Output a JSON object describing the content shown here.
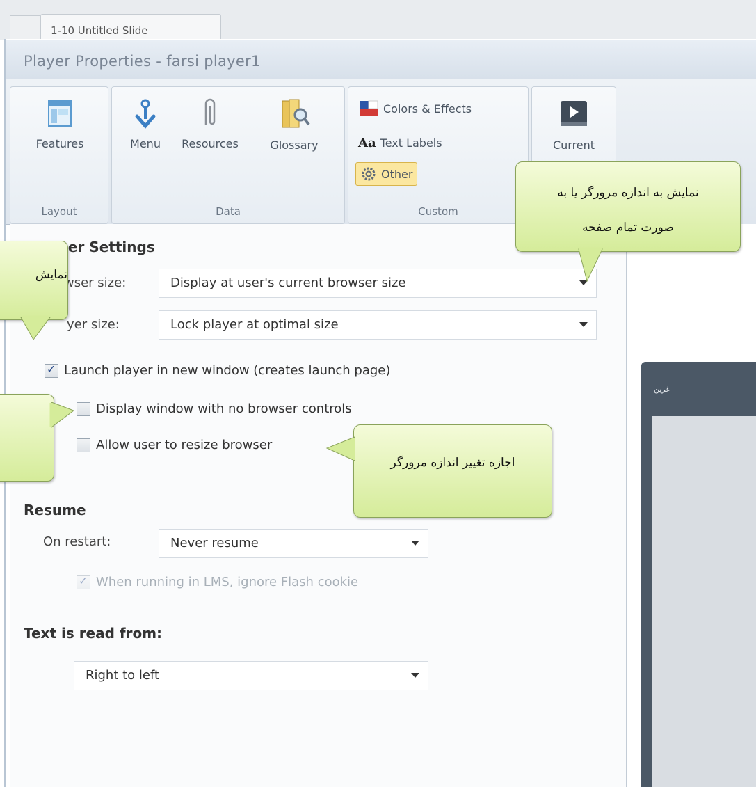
{
  "tab": {
    "label": "1-10 Untitled Slide"
  },
  "window": {
    "title": "Player Properties - farsi player1"
  },
  "ribbon": {
    "groups": [
      {
        "label": "Layout",
        "buttons": [
          {
            "label": "Features",
            "icon": "features-icon"
          }
        ]
      },
      {
        "label": "Data",
        "buttons": [
          {
            "label": "Menu",
            "icon": "menu-icon"
          },
          {
            "label": "Resources",
            "icon": "paperclip-icon"
          },
          {
            "label": "Glossary",
            "icon": "glossary-book-icon"
          }
        ]
      },
      {
        "label": "Custom",
        "items": [
          {
            "label": "Colors & Effects",
            "icon": "flag-colors-icon"
          },
          {
            "label": "Text Labels",
            "icon": "text-aa-icon",
            "icon_text": "Aa"
          },
          {
            "label": "Other",
            "icon": "gear-icon",
            "selected": true
          }
        ]
      },
      {
        "label": "",
        "buttons": [
          {
            "label": "Current",
            "icon": "play-icon"
          }
        ]
      }
    ]
  },
  "browser_settings": {
    "heading": "ser Settings",
    "browser_size": {
      "label": "wser size:",
      "value": "Display at user's current browser size"
    },
    "player_size": {
      "label": "yer size:",
      "value": "Lock player at optimal size"
    },
    "launch_new_window": {
      "label": "Launch player in new window (creates launch page)",
      "checked": true
    },
    "no_browser_controls": {
      "label": "Display window with no browser controls",
      "checked": false
    },
    "allow_resize": {
      "label": "Allow user to resize browser",
      "checked": false
    }
  },
  "resume": {
    "heading": "Resume",
    "on_restart": {
      "label": "On restart:",
      "value": "Never resume"
    },
    "ignore_flash_cookie": {
      "label": "When running in LMS, ignore Flash cookie",
      "checked": true,
      "disabled": true
    }
  },
  "text_direction": {
    "heading": "Text is read from:",
    "value": "Right to left"
  },
  "preview": {
    "title": "غرين"
  },
  "callouts": {
    "top_right_line1": "نمایش به اندازه مرورگر یا به",
    "top_right_line2": "صورت تمام صفحه",
    "left_top": "نمایش",
    "allow_resize": "اجازه تغییر اندازه مرورگر"
  },
  "colors": {
    "callout_fill": "#e3f2b8",
    "callout_border": "#8aa35b",
    "title_text": "#7a8594"
  }
}
